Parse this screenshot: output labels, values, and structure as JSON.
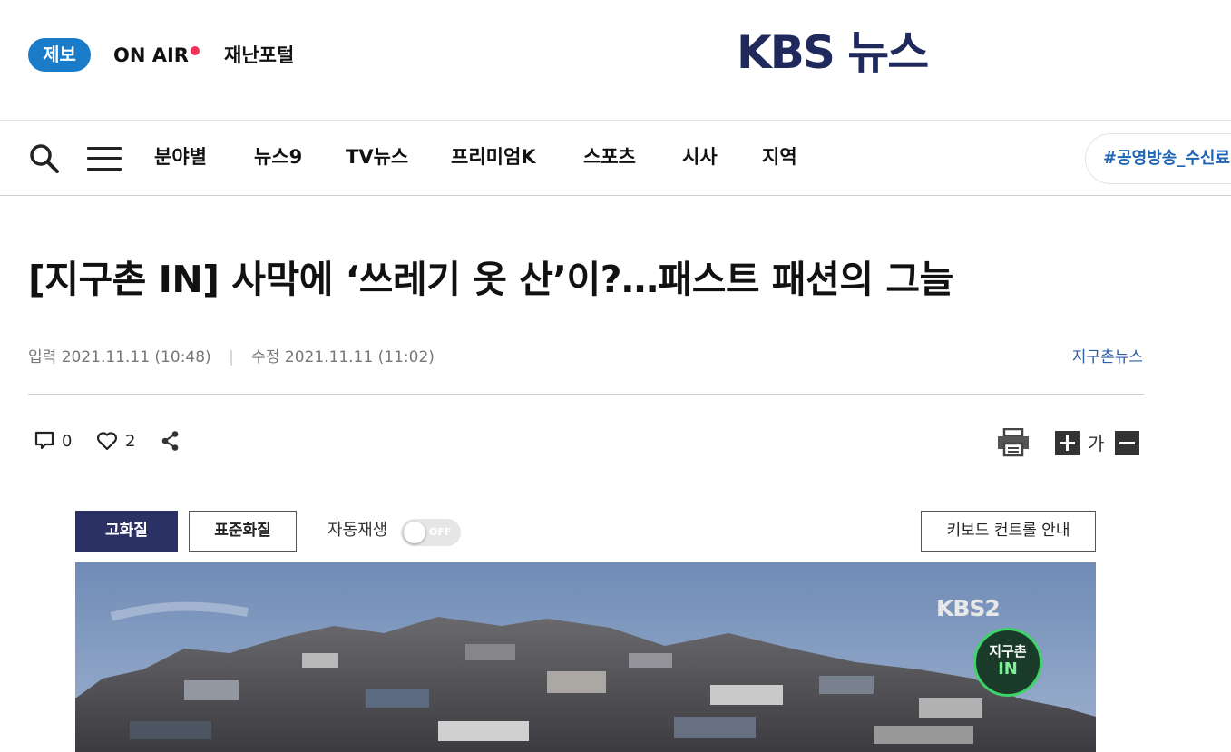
{
  "header": {
    "report_label": "제보",
    "onair_label": "ON AIR",
    "disaster_label": "재난포털",
    "logo_text": "KBS 뉴스"
  },
  "nav": {
    "items": [
      "분야별",
      "뉴스9",
      "TV뉴스",
      "프리미엄K",
      "스포츠",
      "시사",
      "지역"
    ],
    "hashtag": "#공영방송_수신료"
  },
  "article": {
    "headline": "[지구촌 IN] 사막에 ‘쓰레기 옷 산’이?…패스트 패션의 그늘",
    "input_label": "입력",
    "input_time": "2021.11.11 (10:48)",
    "edit_label": "수정",
    "edit_time": "2021.11.11 (11:02)",
    "category": "지구촌뉴스",
    "comment_count": "0",
    "like_count": "2",
    "font_size_label": "가"
  },
  "video": {
    "quality_high": "고화질",
    "quality_standard": "표준화질",
    "autoplay_label": "자동재생",
    "autoplay_state": "OFF",
    "keyboard_guide": "키보드 컨트롤 안내",
    "channel_logo": "KBS2",
    "program_badge_top": "지구촌",
    "program_badge_bottom": "IN"
  },
  "colors": {
    "report_blue": "#1a7cc8",
    "onair_dot": "#f0325a",
    "logo_navy": "#20295c",
    "quality_active": "#2b3164",
    "category_blue": "#2d5fa6",
    "hashtag_blue": "#1f64b4"
  },
  "icons": [
    "search-icon",
    "menu-icon",
    "comment-icon",
    "heart-icon",
    "share-icon",
    "print-icon",
    "plus-icon",
    "minus-icon"
  ]
}
